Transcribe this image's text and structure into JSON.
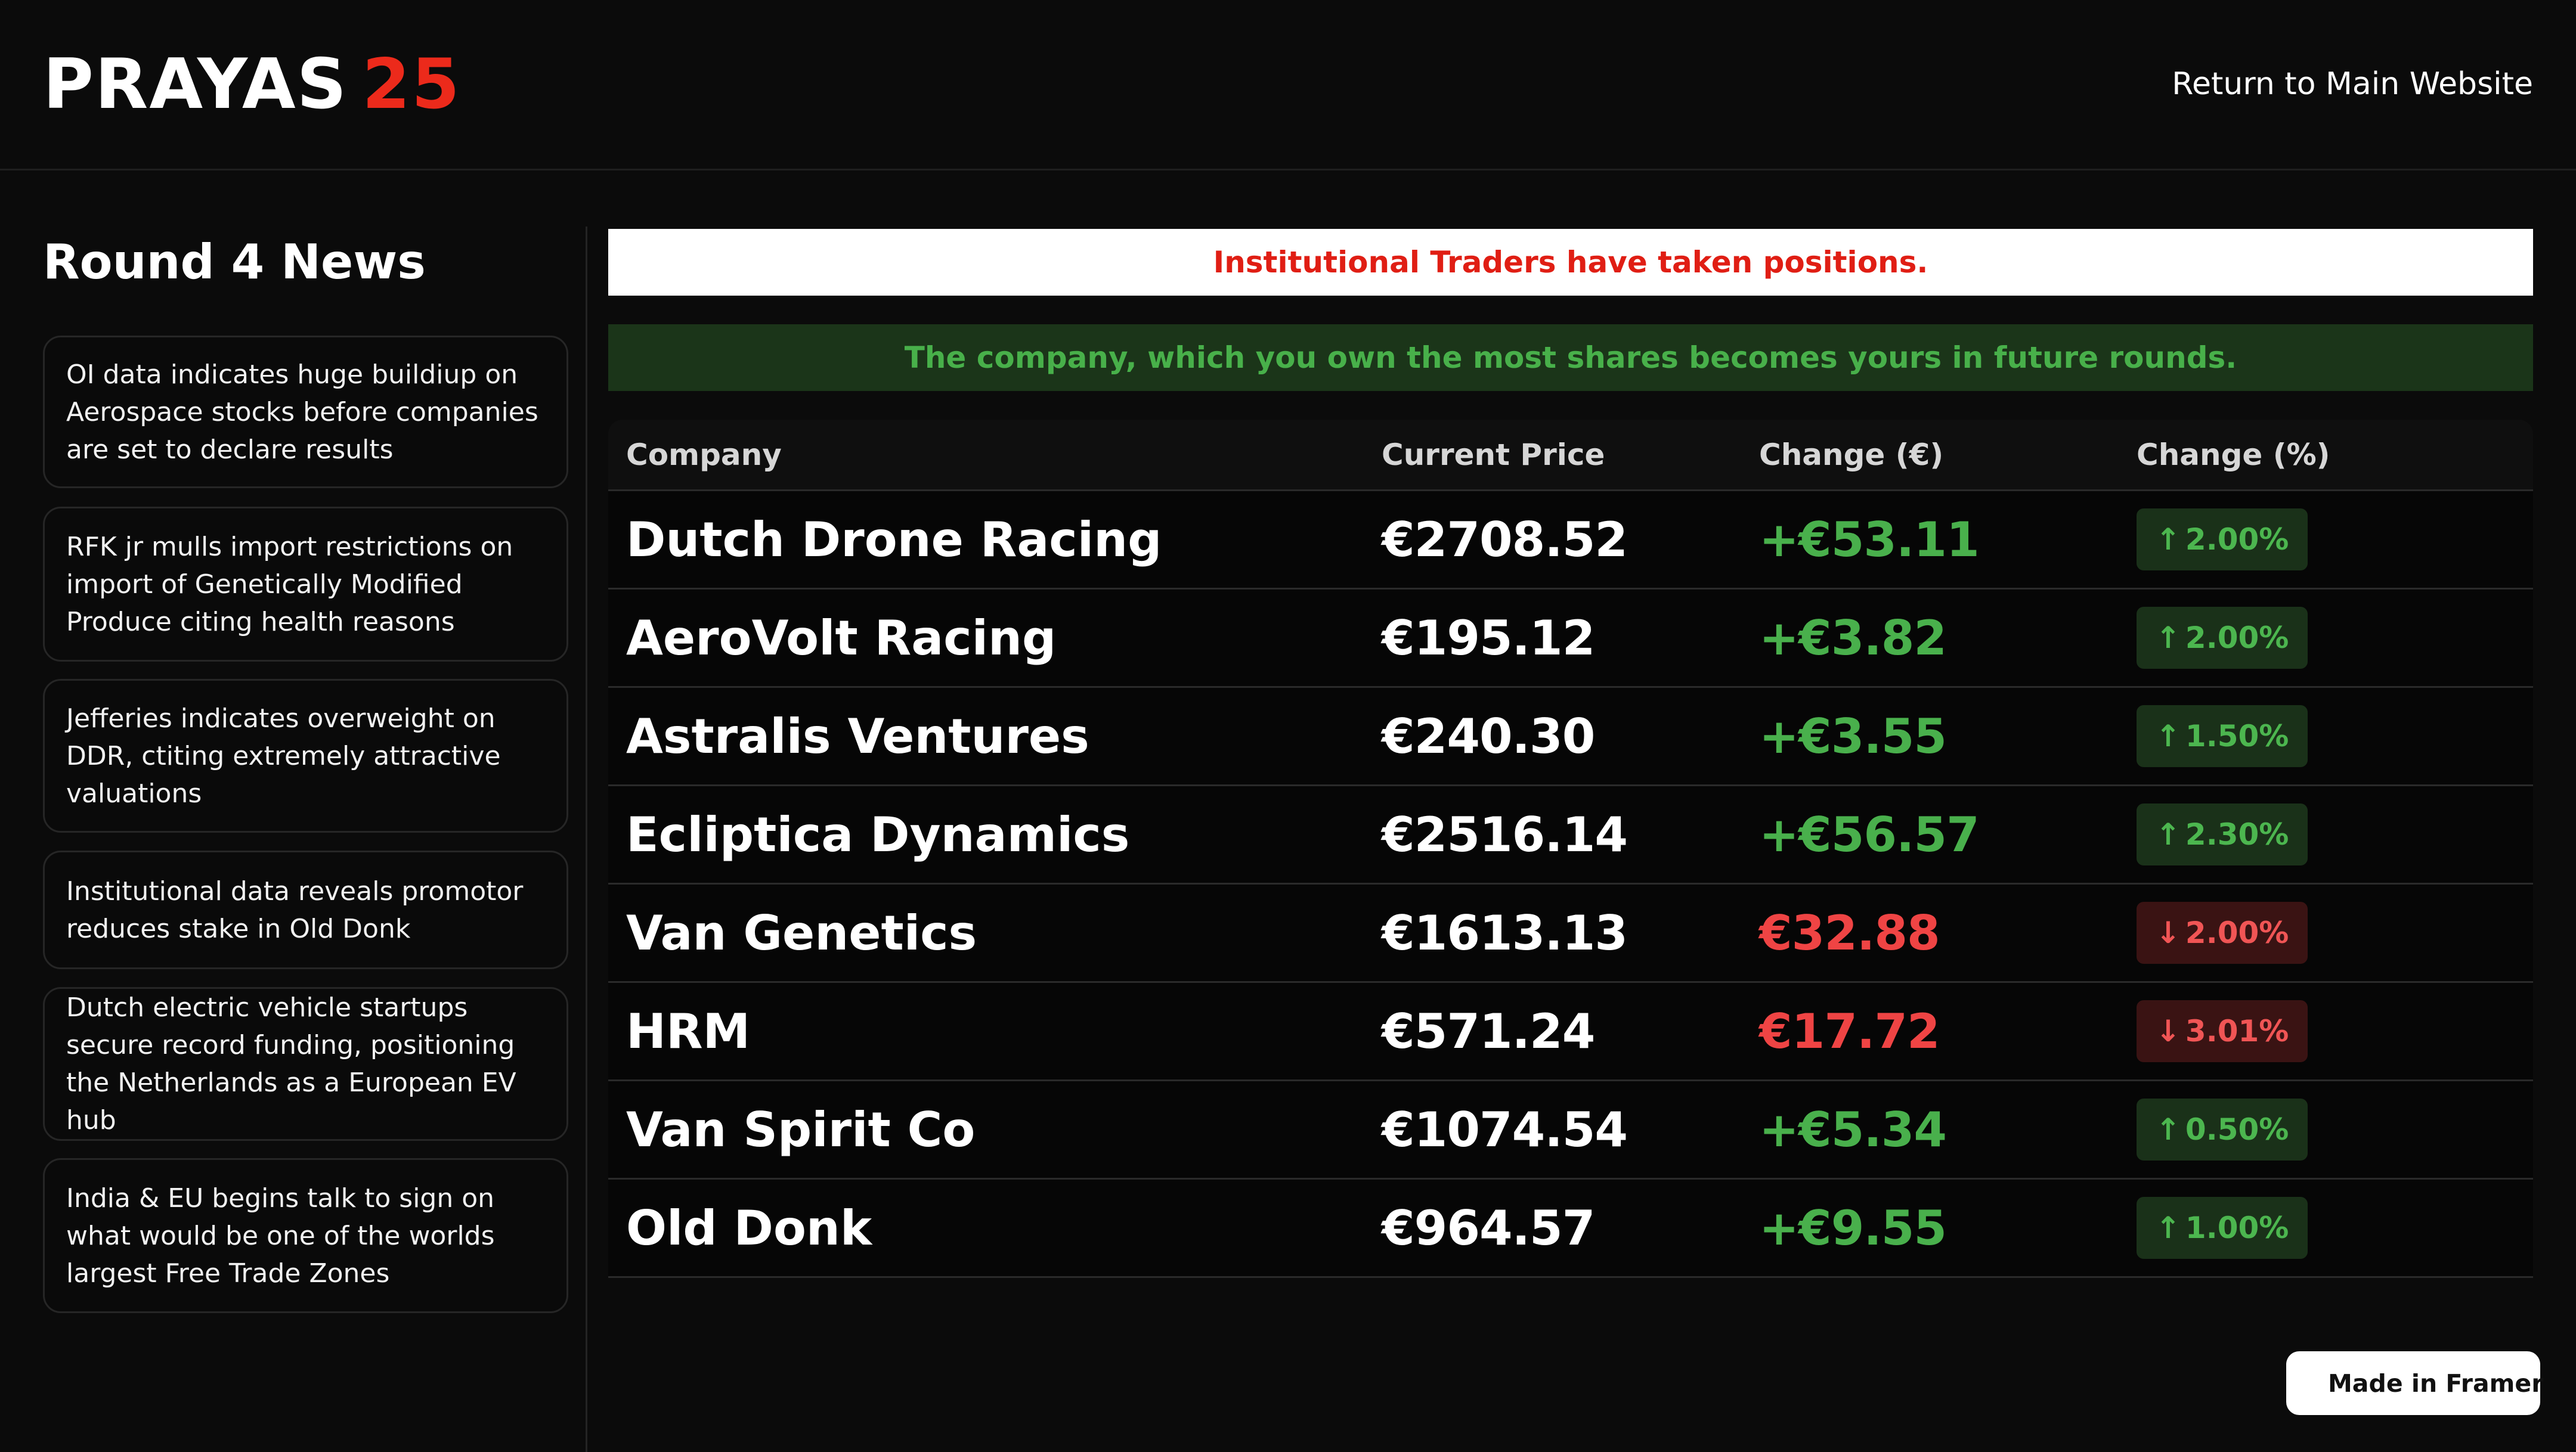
{
  "header": {
    "logo_word": "PRAYAS",
    "logo_number": "25",
    "return_link": "Return to Main Website"
  },
  "sidebar": {
    "title": "Round 4 News",
    "news": [
      "OI data indicates huge buildiup on Aerospace stocks before companies are set to declare results",
      "RFK jr mulls import restrictions on import of Genetically Modified Produce citing health reasons",
      "Jefferies indicates overweight on DDR, ctiting extremely attractive valuations",
      "Institutional data reveals promotor reduces stake in Old Donk",
      "Dutch electric vehicle startups secure record funding, positioning the Netherlands as a European EV hub",
      "India & EU begins talk to sign on what would be one of the worlds largest Free Trade Zones"
    ]
  },
  "banners": {
    "institutional": "Institutional Traders have taken positions.",
    "ownership": "The company, which you own the most shares becomes yours in future rounds."
  },
  "table": {
    "headers": [
      "Company",
      "Current Price",
      "Change (€)",
      "Change (%)"
    ],
    "rows": [
      {
        "company": "Dutch Drone Racing",
        "price": "€2708.52",
        "change": "+€53.11",
        "pct": "2.00%",
        "direction": "up"
      },
      {
        "company": "AeroVolt Racing",
        "price": "€195.12",
        "change": "+€3.82",
        "pct": "2.00%",
        "direction": "up"
      },
      {
        "company": "Astralis Ventures",
        "price": "€240.30",
        "change": "+€3.55",
        "pct": "1.50%",
        "direction": "up"
      },
      {
        "company": "Ecliptica Dynamics",
        "price": "€2516.14",
        "change": "+€56.57",
        "pct": "2.30%",
        "direction": "up"
      },
      {
        "company": "Van Genetics",
        "price": "€1613.13",
        "change": "€32.88",
        "pct": "2.00%",
        "direction": "down"
      },
      {
        "company": "HRM",
        "price": "€571.24",
        "change": "€17.72",
        "pct": "3.01%",
        "direction": "down"
      },
      {
        "company": "Van Spirit Co",
        "price": "€1074.54",
        "change": "+€5.34",
        "pct": "0.50%",
        "direction": "up"
      },
      {
        "company": "Old Donk",
        "price": "€964.57",
        "change": "+€9.55",
        "pct": "1.00%",
        "direction": "up"
      }
    ]
  },
  "framer_badge": {
    "label": "Made in Framer",
    "icon": "framer-logo-icon"
  },
  "colors": {
    "background": "#0b0b0b",
    "brand_red": "#ec2a1b",
    "up_green": "#49b04c",
    "down_red": "#ef4444",
    "green_banner_bg": "#1b3519"
  }
}
